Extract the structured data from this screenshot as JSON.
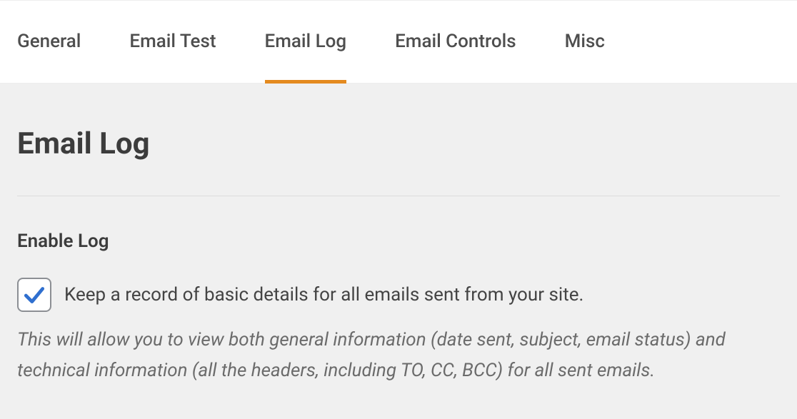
{
  "tabs": {
    "items": [
      {
        "label": "General",
        "active": false
      },
      {
        "label": "Email Test",
        "active": false
      },
      {
        "label": "Email Log",
        "active": true
      },
      {
        "label": "Email Controls",
        "active": false
      },
      {
        "label": "Misc",
        "active": false
      }
    ]
  },
  "panel": {
    "title": "Email Log",
    "enable_log": {
      "label": "Enable Log",
      "checked": true,
      "checkbox_text": "Keep a record of basic details for all emails sent from your site.",
      "help_text": "This will allow you to view both general information (date sent, subject, email status) and technical information (all the headers, including TO, CC, BCC) for all sent emails."
    }
  },
  "colors": {
    "accent": "#e48a1f",
    "check": "#2f6fcf"
  }
}
